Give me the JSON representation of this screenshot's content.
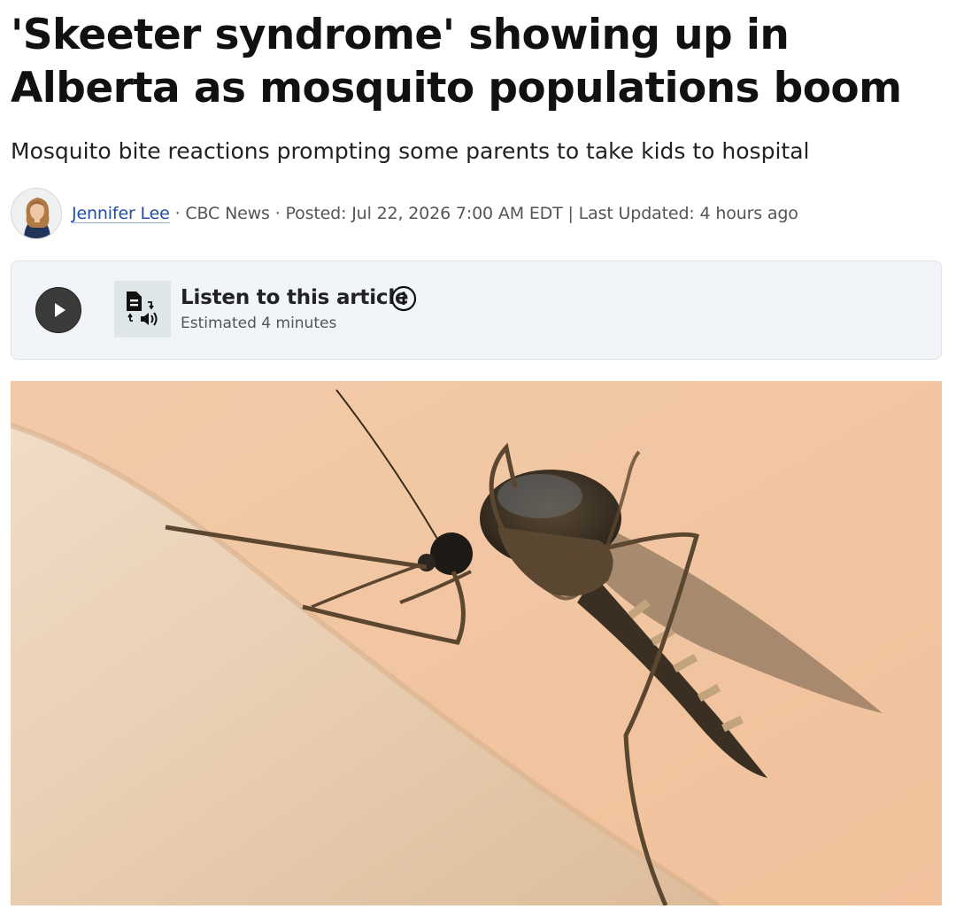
{
  "article": {
    "headline": "'Skeeter syndrome' showing up in Alberta as mosquito populations boom",
    "subheadline": "Mosquito bite reactions prompting some parents to take kids to hospital"
  },
  "byline": {
    "author": "Jennifer Lee",
    "separator": "·",
    "outlet": "CBC News",
    "posted": "Posted: Jul 22, 2026 7:00 AM EDT",
    "divider": "|",
    "updated": "Last Updated: 4 hours ago"
  },
  "listen": {
    "title": "Listen to this article",
    "duration": "Estimated 4 minutes",
    "play_icon": "play-icon",
    "tts_icon": "text-to-speech-icon",
    "info_icon": "info-icon"
  },
  "colors": {
    "author_link": "#1f4fa3",
    "listen_bg": "#f1f4f8",
    "play_button": "#3a3a3a"
  }
}
